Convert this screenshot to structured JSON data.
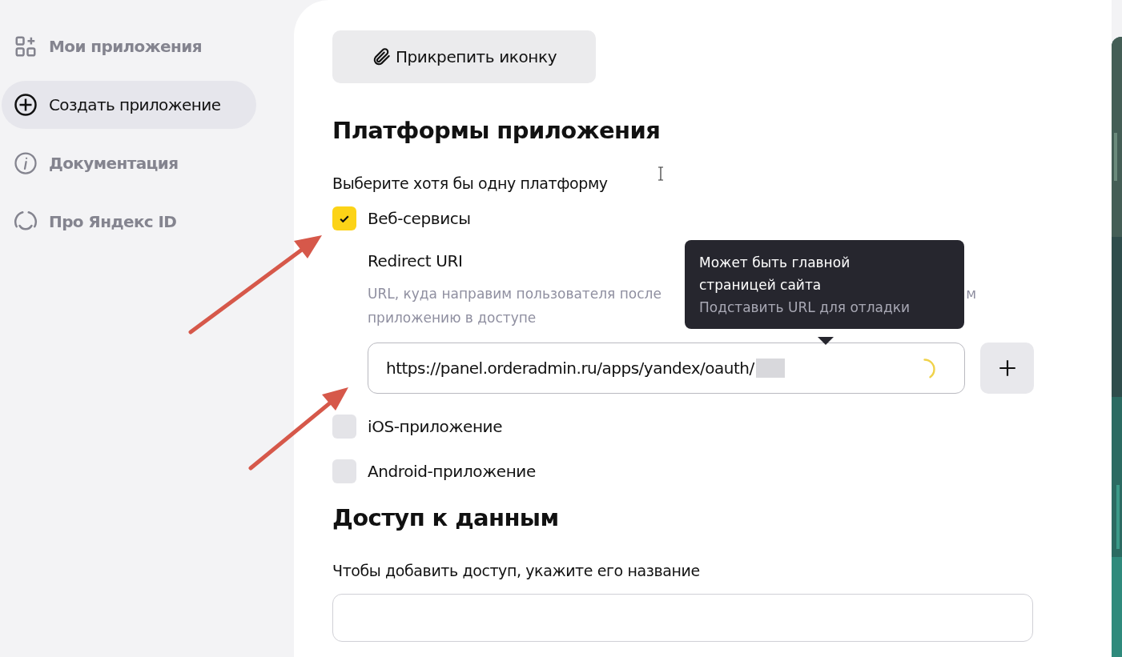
{
  "sidebar": {
    "items": [
      {
        "label": "Мои приложения",
        "selected": false
      },
      {
        "label": "Создать приложение",
        "selected": true
      },
      {
        "label": "Документация",
        "selected": false
      },
      {
        "label": "Про Яндекс ID",
        "selected": false
      }
    ]
  },
  "attach_button": "Прикрепить иконку",
  "platforms": {
    "title": "Платформы приложения",
    "hint": "Выберите хотя бы одну платформу",
    "options": [
      {
        "label": "Веб-сервисы",
        "checked": true,
        "redirect": {
          "label": "Redirect URI",
          "description_line_1": "URL, куда направим пользователя после",
          "description_fragment": "м",
          "description_line_2": "приложению в доступе",
          "value": "https://panel.orderadmin.ru/apps/yandex/oauth/",
          "loading": true,
          "tooltip": {
            "title": "Может быть главной страницей сайта",
            "action": "Подставить URL для отладки"
          }
        }
      },
      {
        "label": "iOS-приложение",
        "checked": false
      },
      {
        "label": "Android-приложение",
        "checked": false
      }
    ]
  },
  "data_access": {
    "title": "Доступ к данным",
    "hint": "Чтобы добавить доступ, укажите его название"
  }
}
